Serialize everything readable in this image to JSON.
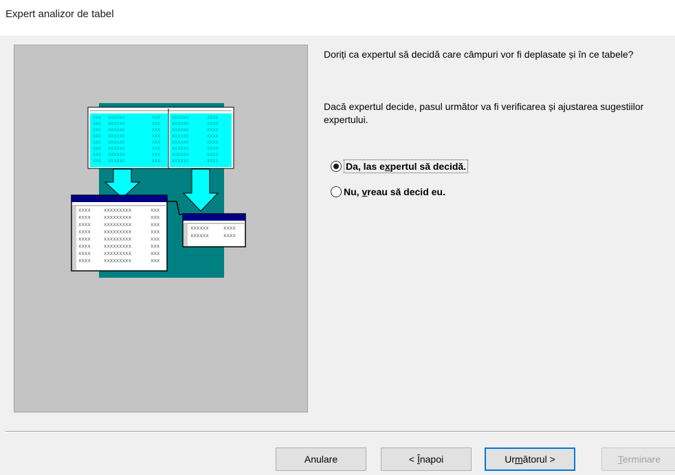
{
  "window": {
    "title": "Expert analizor de tabel"
  },
  "question": "Doriți ca expertul să decidă care câmpuri vor fi deplasate și în ce tabele?",
  "info": "Dacă expertul decide, pasul următor va fi verificarea și ajustarea sugestiilor expertului.",
  "options": [
    {
      "pre": "Da, las e",
      "mnemonic": "x",
      "post": "pertul să decidă.",
      "checked": true
    },
    {
      "pre": "Nu, ",
      "mnemonic": "v",
      "post": "reau să decid eu.",
      "checked": false
    }
  ],
  "illustration": {
    "cell_text": [
      "XXX",
      "XXXXXX",
      "XXX",
      "XXXXXX",
      "XXXX"
    ],
    "left_table_rows": [
      "XXXX",
      "XXXXXXXXX",
      "XXX"
    ],
    "right_table_rows": [
      "XXXXXX",
      "XXXX"
    ]
  },
  "buttons": {
    "cancel": {
      "label": "Anulare"
    },
    "back": {
      "pre": "< ",
      "mnemonic": "Î",
      "post": "napoi"
    },
    "next": {
      "pre": "Ur",
      "mnemonic": "m",
      "post": "ătorul >"
    },
    "finish": {
      "pre": "",
      "mnemonic": "T",
      "post": "erminare",
      "disabled": true
    }
  },
  "colors": {
    "teal": "#008080",
    "cyan": "#00ffff",
    "navy": "#000080",
    "panel_gray": "#c4c4c4",
    "focus_blue": "#0078d7"
  }
}
